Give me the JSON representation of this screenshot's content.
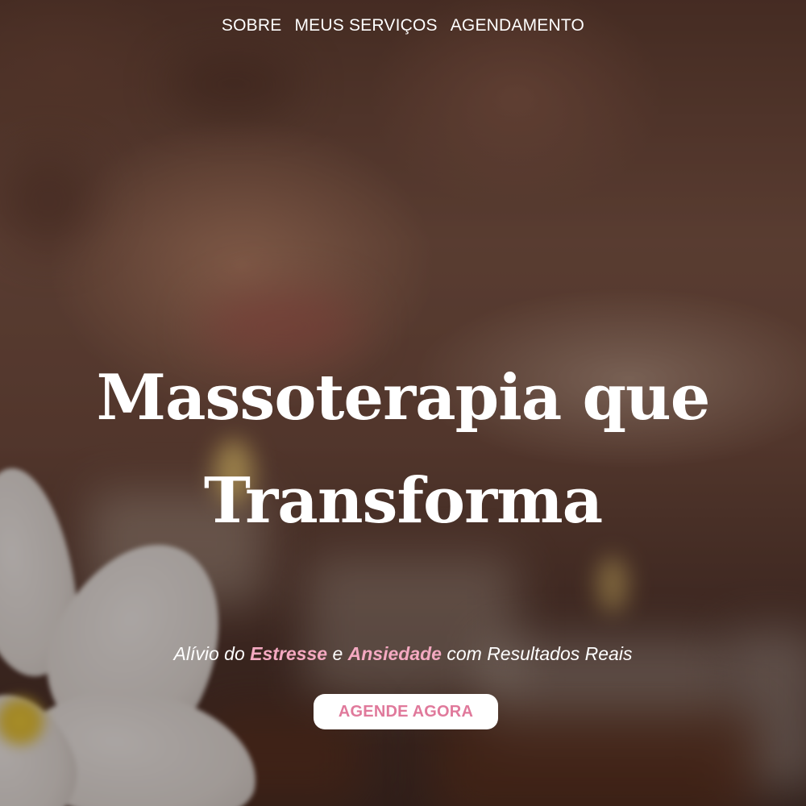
{
  "nav": {
    "items": [
      {
        "label": "SOBRE"
      },
      {
        "label": "MEUS SERVIÇOS"
      },
      {
        "label": "AGENDAMENTO"
      }
    ]
  },
  "hero": {
    "title_line1": "Massoterapia que",
    "title_line2": "Transforma",
    "subtitle": {
      "part1": "Alívio do ",
      "highlight1": "Estresse",
      "part2": " e ",
      "highlight2": "Ansiedade",
      "part3": " com Resultados Reais"
    },
    "cta_label": "AGENDE AGORA",
    "background_image": "spa-massage-background"
  },
  "colors": {
    "accent_pink": "#f4a9c1",
    "cta_text": "#e0799b",
    "cta_bg": "#ffffff",
    "text": "#ffffff"
  }
}
